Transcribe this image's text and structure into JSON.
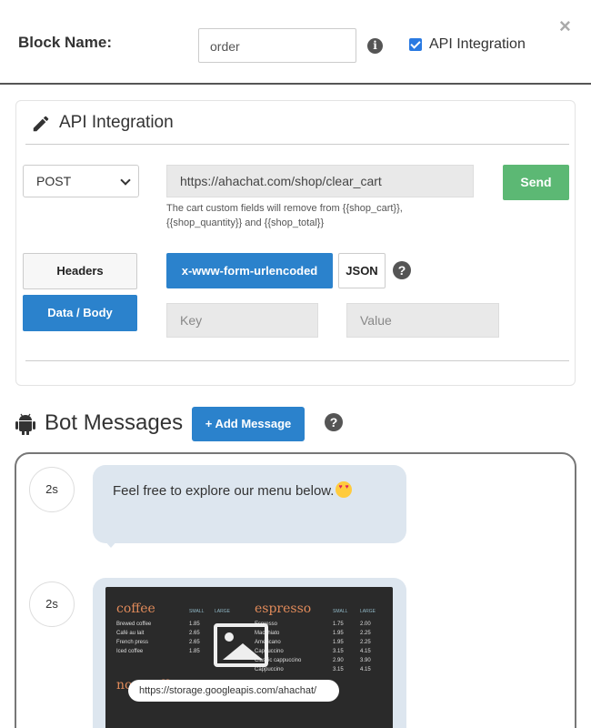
{
  "block": {
    "name_label": "Block Name:",
    "name_value": "order",
    "api_integration_checkbox_label": "API Integration",
    "api_integration_checked": true,
    "close_glyph": "×"
  },
  "api_panel": {
    "title": "API Integration",
    "method": "POST",
    "url": "https://ahachat.com/shop/clear_cart",
    "send_label": "Send",
    "hint": "The cart custom fields will remove from {{shop_cart}}, {{shop_quantity}} and {{shop_total}}",
    "headers_label": "Headers",
    "data_body_label": "Data / Body",
    "urlencoded_label": "x-www-form-urlencoded",
    "json_label": "JSON",
    "key_placeholder": "Key",
    "value_placeholder": "Value"
  },
  "bot_messages": {
    "title": "Bot Messages",
    "add_message_label": "+ Add Message",
    "messages": [
      {
        "delay": "2s",
        "text": "Feel free to explore our menu below."
      },
      {
        "delay": "2s",
        "image_url": "https://storage.googleapis.com/ahachat/"
      }
    ],
    "menu_image": {
      "heading_left": "coffee",
      "heading_right": "espresso",
      "col_small": "SMALL",
      "col_large": "LARGE",
      "left_rows": [
        [
          "Brewed coffee",
          "1.85",
          "2.15"
        ],
        [
          "Café au lait",
          "2.65",
          "2.95"
        ],
        [
          "French press",
          "2.65",
          "2.95"
        ],
        [
          "Iced coffee",
          "1.85",
          "2.15"
        ]
      ],
      "right_rows": [
        [
          "Espresso",
          "1.75",
          "2.00"
        ],
        [
          "Macchiato",
          "1.95",
          "2.25"
        ],
        [
          "Americano",
          "1.95",
          "2.25"
        ],
        [
          "Cappuccino",
          "3.15",
          "4.15"
        ],
        [
          "Classic cappuccino",
          "2.90",
          "3.90"
        ],
        [
          "Cappuccino",
          "3.15",
          "4.15"
        ]
      ],
      "heading_left_2": "non-coffee"
    }
  },
  "colors": {
    "primary": "#2b82cc",
    "success": "#5cb874",
    "bubble": "#dde6ef"
  },
  "icons": {
    "info": "info-icon",
    "pencil": "pencil-icon",
    "help": "question-circle-icon",
    "android": "android-icon",
    "close": "close-icon",
    "image": "image-placeholder-icon"
  }
}
